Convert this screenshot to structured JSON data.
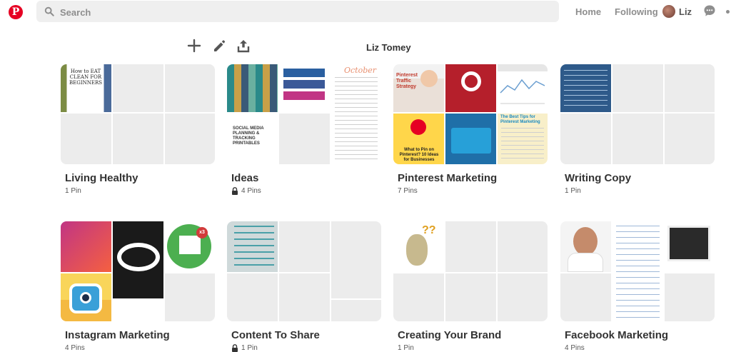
{
  "header": {
    "search_placeholder": "Search",
    "home": "Home",
    "following": "Following",
    "user": "Liz"
  },
  "profile": {
    "name": "Liz Tomey"
  },
  "boards": [
    {
      "title": "Living Healthy",
      "count": "1 Pin",
      "locked": false
    },
    {
      "title": "Ideas",
      "count": "4 Pins",
      "locked": true
    },
    {
      "title": "Pinterest Marketing",
      "count": "7 Pins",
      "locked": false
    },
    {
      "title": "Writing Copy",
      "count": "1 Pin",
      "locked": false
    },
    {
      "title": "Instagram Marketing",
      "count": "4 Pins",
      "locked": false
    },
    {
      "title": "Content To Share",
      "count": "1 Pin",
      "locked": true
    },
    {
      "title": "Creating Your Brand",
      "count": "1 Pin",
      "locked": false
    },
    {
      "title": "Facebook Marketing",
      "count": "4 Pins",
      "locked": false
    }
  ],
  "pin_text": {
    "eat_clean": "How to EAT CLEAN FOR BEGINNERS",
    "october": "October",
    "social_planner": "SOCIAL MEDIA PLANNING & TRACKING PRINTABLES",
    "pinterest_strategy": "Pinterest Traffic Strategy",
    "best_tips": "The Best Tips for Pinterest Marketing",
    "what_to_pin": "What to Pin on Pinterest? 10 Ideas for Businesses",
    "badge_x3": "x3"
  },
  "colors": {
    "brand": "#e60023",
    "placeholder_tile": "#ececec"
  }
}
